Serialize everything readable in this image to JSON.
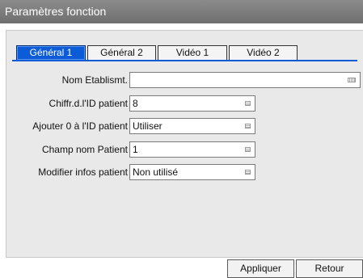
{
  "window": {
    "title": "Paramètres fonction"
  },
  "tabs": [
    {
      "label": "Général 1",
      "active": true
    },
    {
      "label": "Général 2",
      "active": false
    },
    {
      "label": "Vidéo 1",
      "active": false
    },
    {
      "label": "Vidéo 2",
      "active": false
    }
  ],
  "form": {
    "institution_name": {
      "label": "Nom Etablismt.",
      "value": ""
    },
    "patient_id_digits": {
      "label": "Chiffr.d.l'ID patient",
      "value": "8"
    },
    "add_zero_to_id": {
      "label": "Ajouter 0 à l'ID patient",
      "value": "Utiliser"
    },
    "patient_name_field": {
      "label": "Champ nom Patient",
      "value": "1"
    },
    "edit_patient_info": {
      "label": "Modifier infos patient",
      "value": "Non utilisé"
    }
  },
  "buttons": {
    "apply": "Appliquer",
    "back": "Retour"
  },
  "colors": {
    "titlebar": "#7d7d7d",
    "active_tab": "#0b5cd6",
    "panel": "#e9e9e9"
  }
}
